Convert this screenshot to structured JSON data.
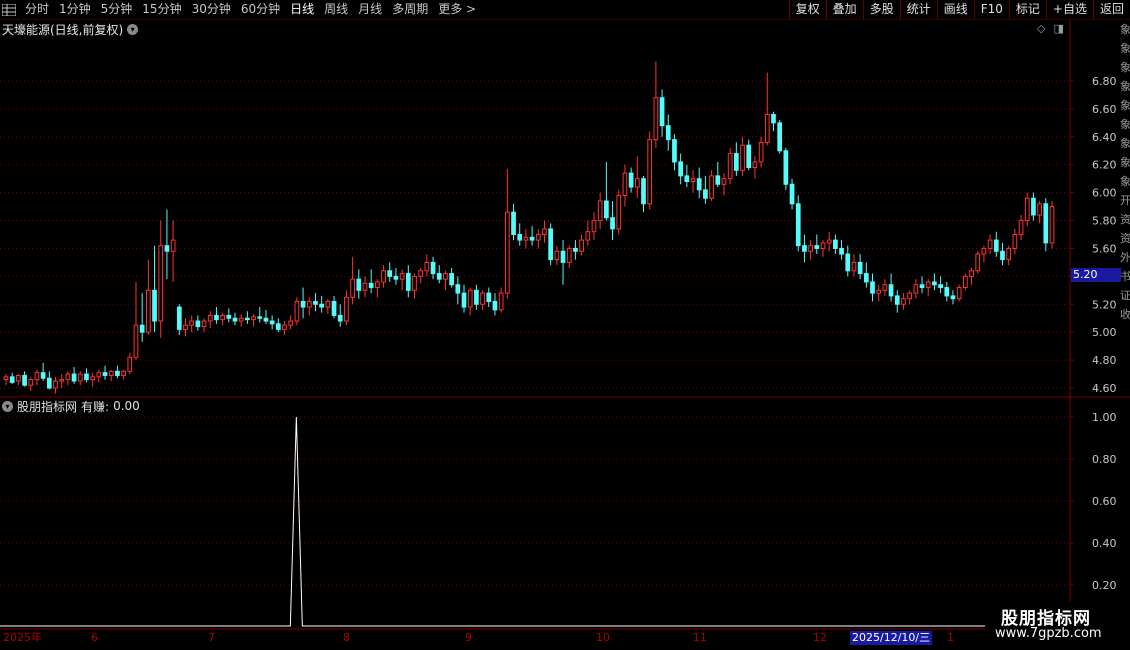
{
  "toolbar": {
    "periods": [
      "分时",
      "1分钟",
      "5分钟",
      "15分钟",
      "30分钟",
      "60分钟",
      "日线",
      "周线",
      "月线",
      "多周期",
      "更多 >"
    ],
    "active": "日线",
    "actions": [
      "复权",
      "叠加",
      "多股",
      "统计",
      "画线",
      "F10",
      "标记",
      "+自选",
      "返回"
    ]
  },
  "main_chart": {
    "title": "天壕能源(日线,前复权)",
    "price_tag": "5.20",
    "y_labels": [
      "6.80",
      "6.60",
      "6.40",
      "6.20",
      "6.00",
      "5.80",
      "5.60",
      "5.40",
      "5.20",
      "5.00",
      "4.80",
      "4.60"
    ]
  },
  "indicator": {
    "name": "股朋指标网",
    "field": "有赚:",
    "value": "0.00",
    "y_labels": [
      "1.00",
      "0.80",
      "0.60",
      "0.40",
      "0.20"
    ]
  },
  "date_axis": {
    "labels": [
      "2025年",
      "6",
      "7",
      "8",
      "9",
      "10",
      "11",
      "12",
      "1"
    ],
    "cursor": "2025/12/10/三"
  },
  "watermark": {
    "name": "股朋指标网",
    "url": "www.7gpzb.com"
  },
  "right_strip": {
    "glyphs": [
      "象",
      "象",
      "象",
      "象",
      "象",
      "象",
      "象",
      "象",
      "象",
      "开",
      "资",
      "资",
      "外",
      "书",
      "证",
      "收"
    ]
  },
  "chart_data": {
    "type": "candlestick",
    "title": "天壕能源(日线,前复权)",
    "ylim": [
      4.45,
      6.95
    ],
    "colors": {
      "up": "#ff3232",
      "down": "#54fcfc",
      "grid": "#7a0000"
    },
    "candles": [
      [
        4.66,
        4.7,
        4.62,
        4.68
      ],
      [
        4.68,
        4.71,
        4.63,
        4.64
      ],
      [
        4.65,
        4.7,
        4.62,
        4.69
      ],
      [
        4.69,
        4.72,
        4.61,
        4.62
      ],
      [
        4.62,
        4.68,
        4.58,
        4.66
      ],
      [
        4.66,
        4.73,
        4.62,
        4.71
      ],
      [
        4.71,
        4.78,
        4.65,
        4.67
      ],
      [
        4.67,
        4.72,
        4.59,
        4.6
      ],
      [
        4.6,
        4.68,
        4.56,
        4.65
      ],
      [
        4.65,
        4.7,
        4.6,
        4.66
      ],
      [
        4.66,
        4.72,
        4.62,
        4.7
      ],
      [
        4.7,
        4.75,
        4.63,
        4.65
      ],
      [
        4.65,
        4.72,
        4.62,
        4.7
      ],
      [
        4.7,
        4.74,
        4.64,
        4.66
      ],
      [
        4.66,
        4.71,
        4.61,
        4.68
      ],
      [
        4.68,
        4.73,
        4.64,
        4.71
      ],
      [
        4.71,
        4.76,
        4.66,
        4.69
      ],
      [
        4.69,
        4.73,
        4.65,
        4.72
      ],
      [
        4.72,
        4.76,
        4.67,
        4.69
      ],
      [
        4.69,
        4.73,
        4.66,
        4.72
      ],
      [
        4.72,
        4.85,
        4.7,
        4.82
      ],
      [
        4.82,
        5.36,
        4.8,
        5.05
      ],
      [
        5.05,
        5.28,
        4.93,
        5.0
      ],
      [
        5.0,
        5.52,
        4.98,
        5.3
      ],
      [
        5.3,
        5.62,
        5.0,
        5.08
      ],
      [
        5.08,
        5.8,
        4.96,
        5.62
      ],
      [
        5.62,
        5.88,
        5.38,
        5.58
      ],
      [
        5.58,
        5.8,
        5.36,
        5.66
      ],
      [
        5.18,
        5.2,
        4.98,
        5.02
      ],
      [
        5.02,
        5.1,
        4.97,
        5.05
      ],
      [
        5.05,
        5.12,
        5.0,
        5.08
      ],
      [
        5.08,
        5.12,
        5.01,
        5.04
      ],
      [
        5.04,
        5.1,
        5.0,
        5.08
      ],
      [
        5.08,
        5.15,
        5.03,
        5.12
      ],
      [
        5.12,
        5.18,
        5.06,
        5.09
      ],
      [
        5.09,
        5.14,
        5.05,
        5.12
      ],
      [
        5.12,
        5.17,
        5.07,
        5.1
      ],
      [
        5.1,
        5.14,
        5.05,
        5.08
      ],
      [
        5.08,
        5.13,
        5.04,
        5.1
      ],
      [
        5.1,
        5.15,
        5.06,
        5.09
      ],
      [
        5.09,
        5.13,
        5.04,
        5.11
      ],
      [
        5.11,
        5.18,
        5.07,
        5.1
      ],
      [
        5.1,
        5.16,
        5.06,
        5.08
      ],
      [
        5.08,
        5.12,
        5.02,
        5.06
      ],
      [
        5.06,
        5.1,
        5.0,
        5.02
      ],
      [
        5.02,
        5.08,
        4.98,
        5.05
      ],
      [
        5.05,
        5.12,
        5.02,
        5.08
      ],
      [
        5.08,
        5.25,
        5.05,
        5.22
      ],
      [
        5.22,
        5.32,
        5.1,
        5.18
      ],
      [
        5.18,
        5.25,
        5.12,
        5.22
      ],
      [
        5.22,
        5.28,
        5.15,
        5.2
      ],
      [
        5.2,
        5.26,
        5.14,
        5.18
      ],
      [
        5.18,
        5.24,
        5.13,
        5.22
      ],
      [
        5.22,
        5.26,
        5.1,
        5.12
      ],
      [
        5.12,
        5.2,
        5.04,
        5.08
      ],
      [
        5.08,
        5.3,
        5.05,
        5.25
      ],
      [
        5.25,
        5.54,
        5.2,
        5.38
      ],
      [
        5.38,
        5.45,
        5.24,
        5.3
      ],
      [
        5.3,
        5.4,
        5.25,
        5.35
      ],
      [
        5.35,
        5.45,
        5.28,
        5.32
      ],
      [
        5.32,
        5.38,
        5.25,
        5.36
      ],
      [
        5.36,
        5.48,
        5.32,
        5.44
      ],
      [
        5.44,
        5.5,
        5.36,
        5.4
      ],
      [
        5.4,
        5.46,
        5.34,
        5.38
      ],
      [
        5.38,
        5.45,
        5.3,
        5.42
      ],
      [
        5.42,
        5.48,
        5.25,
        5.3
      ],
      [
        5.3,
        5.42,
        5.24,
        5.4
      ],
      [
        5.4,
        5.46,
        5.35,
        5.44
      ],
      [
        5.44,
        5.56,
        5.4,
        5.5
      ],
      [
        5.5,
        5.54,
        5.38,
        5.42
      ],
      [
        5.42,
        5.48,
        5.35,
        5.38
      ],
      [
        5.38,
        5.44,
        5.3,
        5.42
      ],
      [
        5.42,
        5.46,
        5.32,
        5.34
      ],
      [
        5.34,
        5.4,
        5.2,
        5.28
      ],
      [
        5.28,
        5.34,
        5.14,
        5.18
      ],
      [
        5.18,
        5.32,
        5.12,
        5.3
      ],
      [
        5.3,
        5.34,
        5.16,
        5.2
      ],
      [
        5.2,
        5.3,
        5.16,
        5.28
      ],
      [
        5.28,
        5.32,
        5.18,
        5.22
      ],
      [
        5.22,
        5.28,
        5.12,
        5.16
      ],
      [
        5.16,
        5.32,
        5.14,
        5.28
      ],
      [
        5.28,
        6.17,
        5.24,
        5.86
      ],
      [
        5.86,
        5.92,
        5.66,
        5.7
      ],
      [
        5.7,
        5.78,
        5.62,
        5.66
      ],
      [
        5.66,
        5.74,
        5.6,
        5.68
      ],
      [
        5.68,
        5.76,
        5.62,
        5.66
      ],
      [
        5.66,
        5.74,
        5.6,
        5.7
      ],
      [
        5.7,
        5.8,
        5.64,
        5.74
      ],
      [
        5.74,
        5.78,
        5.48,
        5.52
      ],
      [
        5.52,
        5.62,
        5.48,
        5.58
      ],
      [
        5.58,
        5.66,
        5.34,
        5.5
      ],
      [
        5.5,
        5.62,
        5.46,
        5.6
      ],
      [
        5.6,
        5.66,
        5.52,
        5.58
      ],
      [
        5.58,
        5.7,
        5.55,
        5.66
      ],
      [
        5.66,
        5.8,
        5.62,
        5.72
      ],
      [
        5.72,
        5.86,
        5.66,
        5.8
      ],
      [
        5.8,
        6.0,
        5.74,
        5.94
      ],
      [
        5.94,
        6.22,
        5.8,
        5.82
      ],
      [
        5.82,
        5.94,
        5.66,
        5.74
      ],
      [
        5.74,
        6.02,
        5.7,
        5.98
      ],
      [
        5.98,
        6.2,
        5.9,
        6.14
      ],
      [
        6.14,
        6.18,
        6.0,
        6.04
      ],
      [
        6.04,
        6.26,
        5.96,
        6.1
      ],
      [
        6.1,
        6.12,
        5.86,
        5.92
      ],
      [
        5.92,
        6.44,
        5.88,
        6.38
      ],
      [
        6.38,
        6.94,
        6.32,
        6.68
      ],
      [
        6.68,
        6.74,
        6.4,
        6.48
      ],
      [
        6.48,
        6.56,
        6.3,
        6.38
      ],
      [
        6.38,
        6.42,
        6.16,
        6.22
      ],
      [
        6.22,
        6.28,
        6.06,
        6.12
      ],
      [
        6.12,
        6.2,
        6.04,
        6.08
      ],
      [
        6.08,
        6.16,
        6.0,
        6.1
      ],
      [
        6.1,
        6.18,
        5.96,
        6.02
      ],
      [
        6.02,
        6.12,
        5.92,
        5.96
      ],
      [
        5.96,
        6.16,
        5.94,
        6.12
      ],
      [
        6.12,
        6.22,
        6.04,
        6.06
      ],
      [
        6.06,
        6.14,
        5.98,
        6.1
      ],
      [
        6.1,
        6.32,
        6.06,
        6.28
      ],
      [
        6.28,
        6.36,
        6.12,
        6.16
      ],
      [
        6.16,
        6.4,
        6.12,
        6.34
      ],
      [
        6.34,
        6.38,
        6.16,
        6.18
      ],
      [
        6.18,
        6.26,
        6.1,
        6.22
      ],
      [
        6.22,
        6.4,
        6.18,
        6.36
      ],
      [
        6.36,
        6.86,
        6.34,
        6.56
      ],
      [
        6.56,
        6.58,
        6.44,
        6.5
      ],
      [
        6.5,
        6.52,
        6.28,
        6.3
      ],
      [
        6.3,
        6.32,
        6.02,
        6.06
      ],
      [
        6.06,
        6.1,
        5.88,
        5.92
      ],
      [
        5.92,
        5.98,
        5.58,
        5.62
      ],
      [
        5.62,
        5.7,
        5.5,
        5.58
      ],
      [
        5.58,
        5.66,
        5.52,
        5.62
      ],
      [
        5.62,
        5.7,
        5.56,
        5.6
      ],
      [
        5.6,
        5.66,
        5.54,
        5.64
      ],
      [
        5.64,
        5.72,
        5.58,
        5.66
      ],
      [
        5.66,
        5.7,
        5.56,
        5.6
      ],
      [
        5.6,
        5.66,
        5.52,
        5.56
      ],
      [
        5.56,
        5.62,
        5.4,
        5.44
      ],
      [
        5.44,
        5.56,
        5.4,
        5.5
      ],
      [
        5.5,
        5.56,
        5.38,
        5.42
      ],
      [
        5.42,
        5.5,
        5.32,
        5.36
      ],
      [
        5.36,
        5.42,
        5.22,
        5.28
      ],
      [
        5.28,
        5.34,
        5.22,
        5.3
      ],
      [
        5.3,
        5.38,
        5.26,
        5.34
      ],
      [
        5.34,
        5.42,
        5.22,
        5.26
      ],
      [
        5.26,
        5.3,
        5.14,
        5.2
      ],
      [
        5.2,
        5.28,
        5.16,
        5.24
      ],
      [
        5.24,
        5.3,
        5.2,
        5.28
      ],
      [
        5.28,
        5.38,
        5.24,
        5.34
      ],
      [
        5.34,
        5.4,
        5.28,
        5.32
      ],
      [
        5.32,
        5.38,
        5.26,
        5.36
      ],
      [
        5.36,
        5.42,
        5.3,
        5.34
      ],
      [
        5.34,
        5.4,
        5.28,
        5.32
      ],
      [
        5.32,
        5.36,
        5.22,
        5.26
      ],
      [
        5.26,
        5.3,
        5.2,
        5.24
      ],
      [
        5.24,
        5.34,
        5.22,
        5.32
      ],
      [
        5.32,
        5.42,
        5.3,
        5.4
      ],
      [
        5.4,
        5.46,
        5.34,
        5.44
      ],
      [
        5.44,
        5.58,
        5.42,
        5.56
      ],
      [
        5.56,
        5.62,
        5.5,
        5.6
      ],
      [
        5.6,
        5.7,
        5.56,
        5.66
      ],
      [
        5.66,
        5.72,
        5.54,
        5.58
      ],
      [
        5.58,
        5.64,
        5.48,
        5.52
      ],
      [
        5.52,
        5.62,
        5.48,
        5.6
      ],
      [
        5.6,
        5.74,
        5.56,
        5.7
      ],
      [
        5.7,
        5.84,
        5.66,
        5.8
      ],
      [
        5.8,
        6.0,
        5.76,
        5.96
      ],
      [
        5.96,
        6.0,
        5.8,
        5.84
      ],
      [
        5.84,
        5.94,
        5.78,
        5.92
      ],
      [
        5.92,
        5.96,
        5.58,
        5.64
      ],
      [
        5.64,
        5.94,
        5.6,
        5.9
      ]
    ],
    "signal": {
      "name": "有赚",
      "ylim": [
        0,
        1.08
      ],
      "bars": 180,
      "spike_at": 49,
      "spike_value": 1.0
    }
  }
}
